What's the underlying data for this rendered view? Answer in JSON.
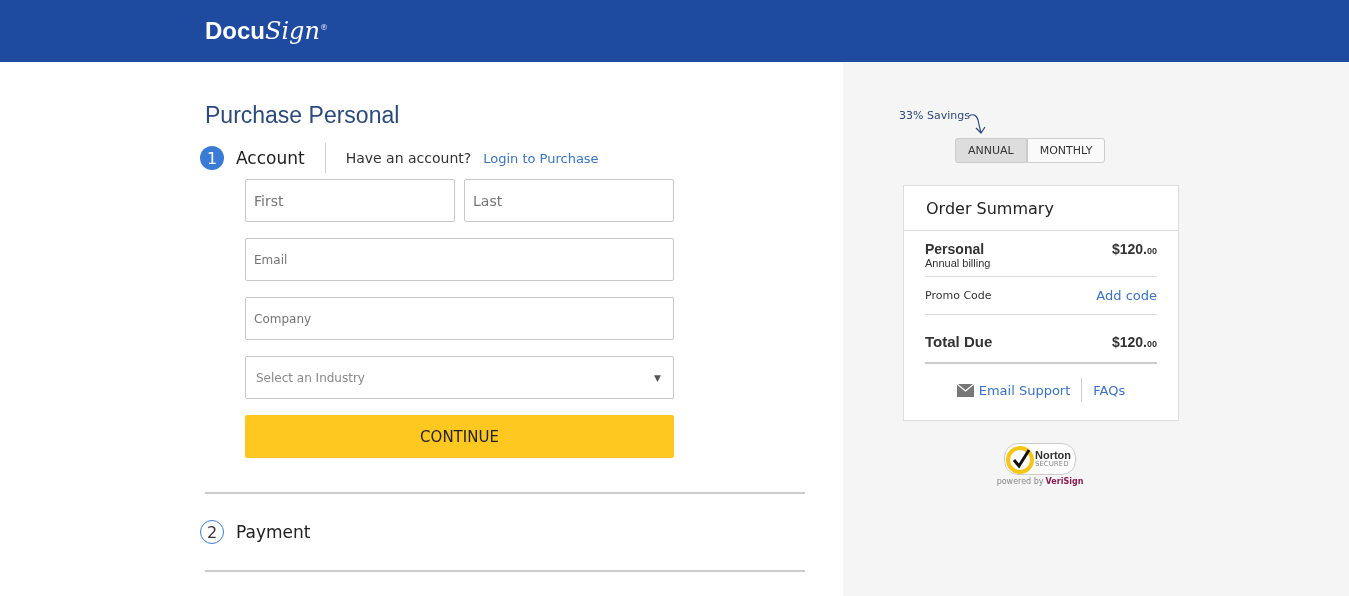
{
  "header": {
    "logo_main": "Docu",
    "logo_script": "Sign$^{®}$"
  },
  "title": "Purchase Personal",
  "steps": [
    {
      "number": "1",
      "label": "Account",
      "selected": true,
      "prompt": "Have an account?",
      "link": "Login to Purchase"
    },
    {
      "number": "2",
      "label": "Payment",
      "selected": false
    }
  ],
  "form": {
    "first": {
      "placeholder": "First"
    },
    "last": {
      "placeholder": "Last"
    },
    "email": {
      "placeholder": "Email"
    },
    "company": {
      "placeholder": "Company"
    },
    "industry": {
      "placeholder": "Select an Industry",
      "caret": "▼"
    },
    "submit": "CONTINUE"
  },
  "billing": {
    "savings": "33% Savings",
    "options": [
      {
        "label": "ANNUAL",
        "selected": true
      },
      {
        "label": "MONTHLY",
        "selected": false
      }
    ]
  },
  "summary": {
    "title": "Order Summary",
    "plan": "Personal",
    "plan_note": "Annual billing",
    "plan_price": "$120.",
    "plan_cents": "00",
    "promo_label": "Promo Code",
    "promo_link": "Add code",
    "total_label": "Total Due",
    "total_price": "$120.",
    "total_cents": "00",
    "email_support": "Email Support",
    "faqs": "FAQs"
  },
  "badge": {
    "name": "Norton",
    "status": "SECURED",
    "powered": "powered by",
    "provider": "VeriSign"
  }
}
